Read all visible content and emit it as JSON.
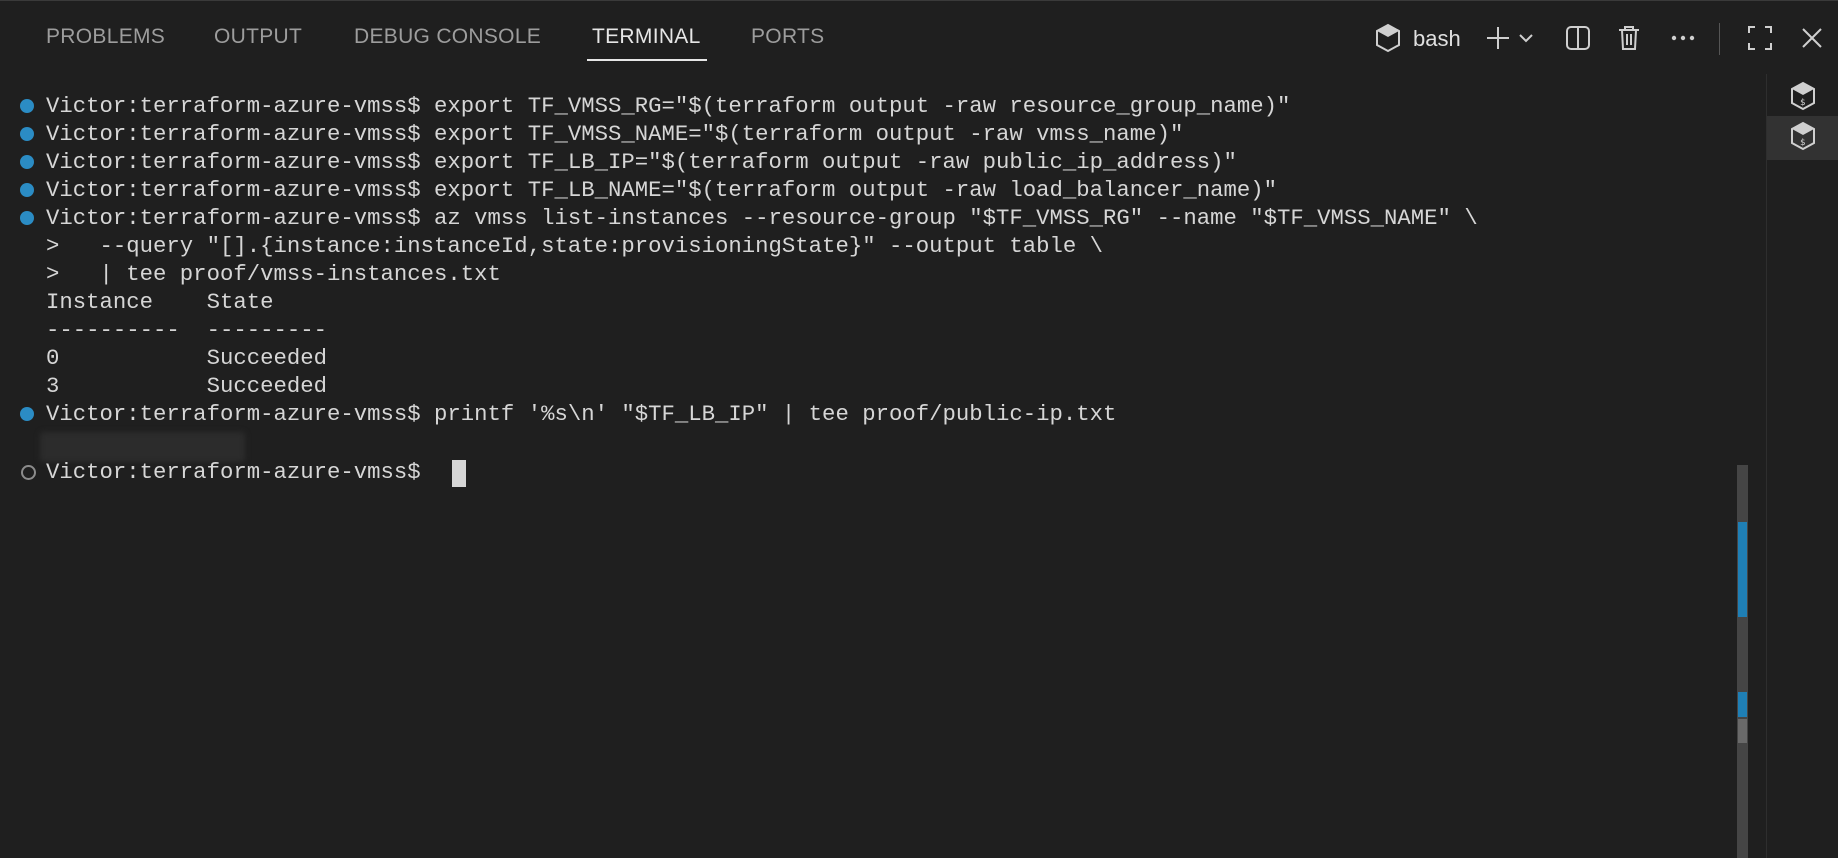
{
  "tabs": [
    {
      "label": "PROBLEMS"
    },
    {
      "label": "OUTPUT"
    },
    {
      "label": "DEBUG CONSOLE"
    },
    {
      "label": "TERMINAL"
    },
    {
      "label": "PORTS"
    }
  ],
  "active_tab": "TERMINAL",
  "toolbar": {
    "shell_label": "bash",
    "icons": [
      "terminal-profile-icon",
      "add-terminal-icon",
      "chevron-down-icon",
      "split-terminal-icon",
      "trash-icon",
      "more-actions-icon",
      "maximize-icon",
      "close-icon"
    ]
  },
  "terminal": {
    "lines": [
      {
        "text": "Victor:terraform-azure-vmss$ export TF_VMSS_RG=\"$(terraform output -raw resource_group_name)\"",
        "marker": "filled"
      },
      {
        "text": "Victor:terraform-azure-vmss$ export TF_VMSS_NAME=\"$(terraform output -raw vmss_name)\"",
        "marker": "filled"
      },
      {
        "text": "Victor:terraform-azure-vmss$ export TF_LB_IP=\"$(terraform output -raw public_ip_address)\"",
        "marker": "filled"
      },
      {
        "text": "Victor:terraform-azure-vmss$ export TF_LB_NAME=\"$(terraform output -raw load_balancer_name)\"",
        "marker": "filled"
      },
      {
        "text": "Victor:terraform-azure-vmss$ az vmss list-instances --resource-group \"$TF_VMSS_RG\" --name \"$TF_VMSS_NAME\" \\",
        "marker": "filled"
      },
      {
        "text": ">   --query \"[].{instance:instanceId,state:provisioningState}\" --output table \\",
        "marker": "none"
      },
      {
        "text": ">   | tee proof/vmss-instances.txt",
        "marker": "none"
      },
      {
        "text": "Instance    State",
        "marker": "none"
      },
      {
        "text": "----------  ---------",
        "marker": "none"
      },
      {
        "text": "0           Succeeded",
        "marker": "none"
      },
      {
        "text": "3           Succeeded",
        "marker": "none"
      },
      {
        "text": "Victor:terraform-azure-vmss$ printf '%s\\n' \"$TF_LB_IP\" | tee proof/public-ip.txt",
        "marker": "filled"
      },
      {
        "text": "",
        "marker": "none"
      },
      {
        "text": "Victor:terraform-azure-vmss$ ",
        "marker": "empty"
      }
    ],
    "redacted_output": true
  },
  "side_panel": {
    "items": [
      {
        "icon": "bash-terminal-icon",
        "active": false
      },
      {
        "icon": "bash-terminal-icon",
        "active": true
      }
    ]
  },
  "colors": {
    "background": "#1f1f1f",
    "accent": "#2b8cc4",
    "text": "#d6d6d6"
  }
}
